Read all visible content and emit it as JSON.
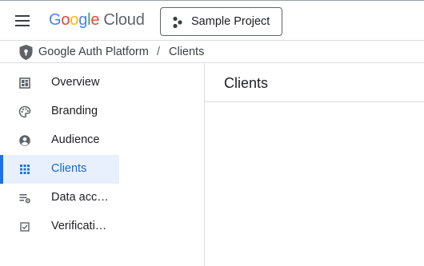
{
  "header": {
    "logo_letters": [
      {
        "char": "G",
        "color": "#4285f4"
      },
      {
        "char": "o",
        "color": "#ea4335"
      },
      {
        "char": "o",
        "color": "#fbbc04"
      },
      {
        "char": "g",
        "color": "#4285f4"
      },
      {
        "char": "l",
        "color": "#34a853"
      },
      {
        "char": "e",
        "color": "#ea4335"
      }
    ],
    "logo_product": "Cloud",
    "project_label": "Sample Project",
    "menu_icon": "hamburger-menu-icon",
    "project_icon": "project-dots-icon"
  },
  "breadcrumb": {
    "icon": "shield-icon",
    "items": [
      "Google Auth Platform",
      "Clients"
    ],
    "separator": "/"
  },
  "sidebar": {
    "items": [
      {
        "label": "Overview",
        "icon": "dashboard-icon",
        "active": false
      },
      {
        "label": "Branding",
        "icon": "palette-icon",
        "active": false
      },
      {
        "label": "Audience",
        "icon": "account-circle-icon",
        "active": false
      },
      {
        "label": "Clients",
        "icon": "apps-grid-icon",
        "active": true
      },
      {
        "label": "Data acc…",
        "icon": "data-access-icon",
        "active": false
      },
      {
        "label": "Verificati…",
        "icon": "verification-checkbox-icon",
        "active": false
      }
    ]
  },
  "main": {
    "title": "Clients"
  },
  "colors": {
    "accent": "#1a73e8",
    "active_bg": "#e8f0fe",
    "active_text": "#1967d2",
    "icon": "#5f6368",
    "divider": "#dadce0"
  }
}
